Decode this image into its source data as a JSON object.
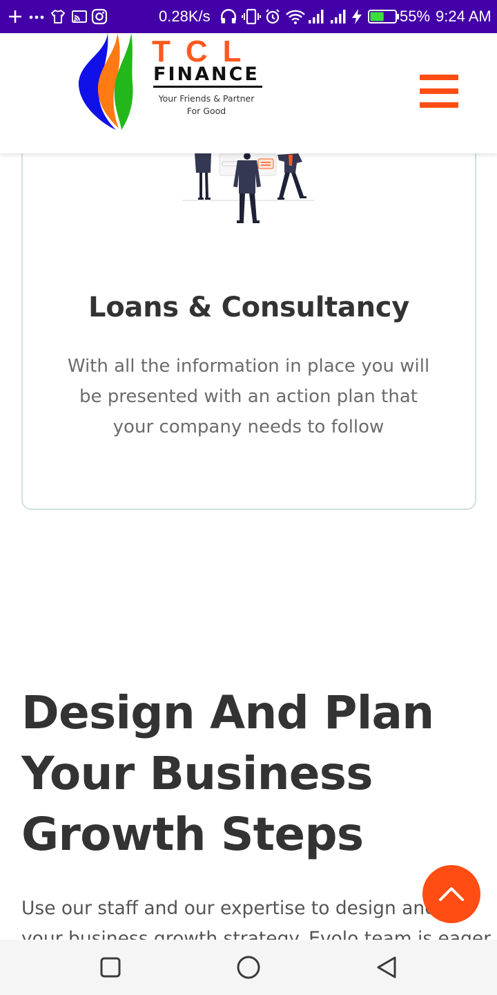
{
  "status_bar": {
    "net_speed": "0.28K/s",
    "battery": "55%",
    "time": "9:24 AM",
    "icons": [
      "plus-icon",
      "more-dots-icon",
      "shirt-icon",
      "cast-icon",
      "instagram-icon",
      "headphones-icon",
      "vibrate-icon",
      "alarm-icon",
      "wifi-icon",
      "signal-icon",
      "signal-icon",
      "charging-icon",
      "battery-icon"
    ],
    "battery_level": 0.55
  },
  "header": {
    "brand": {
      "name": "TCL",
      "subname": "FINANCE",
      "tagline": [
        "Your Friends & Partner",
        "For Good"
      ]
    },
    "menu_icon": "hamburger-menu-icon"
  },
  "card": {
    "illustration": "business-team-illustration",
    "title": "Loans & Consultancy",
    "description_lines": [
      "With all the information in place you will",
      "be presented with an action plan that",
      "your company needs to follow"
    ]
  },
  "section": {
    "heading_lines": [
      "Design And Plan",
      "Your Business",
      "Growth Steps"
    ],
    "text_lines": [
      "Use our staff and our expertise to design and p",
      "your business growth strategy. Evolo team is eager"
    ]
  },
  "scroll_top": {
    "icon": "chevron-up-icon"
  },
  "nav_bar": {
    "buttons": [
      "recents-square-icon",
      "home-circle-icon",
      "back-triangle-icon"
    ]
  },
  "colors": {
    "status_bar": "#4300a8",
    "accent": "#ff4d13",
    "heading": "#333333",
    "body_text": "#6b6b6b",
    "card_border": "#cfe0df",
    "nav_bar": "#f5f5f5"
  }
}
